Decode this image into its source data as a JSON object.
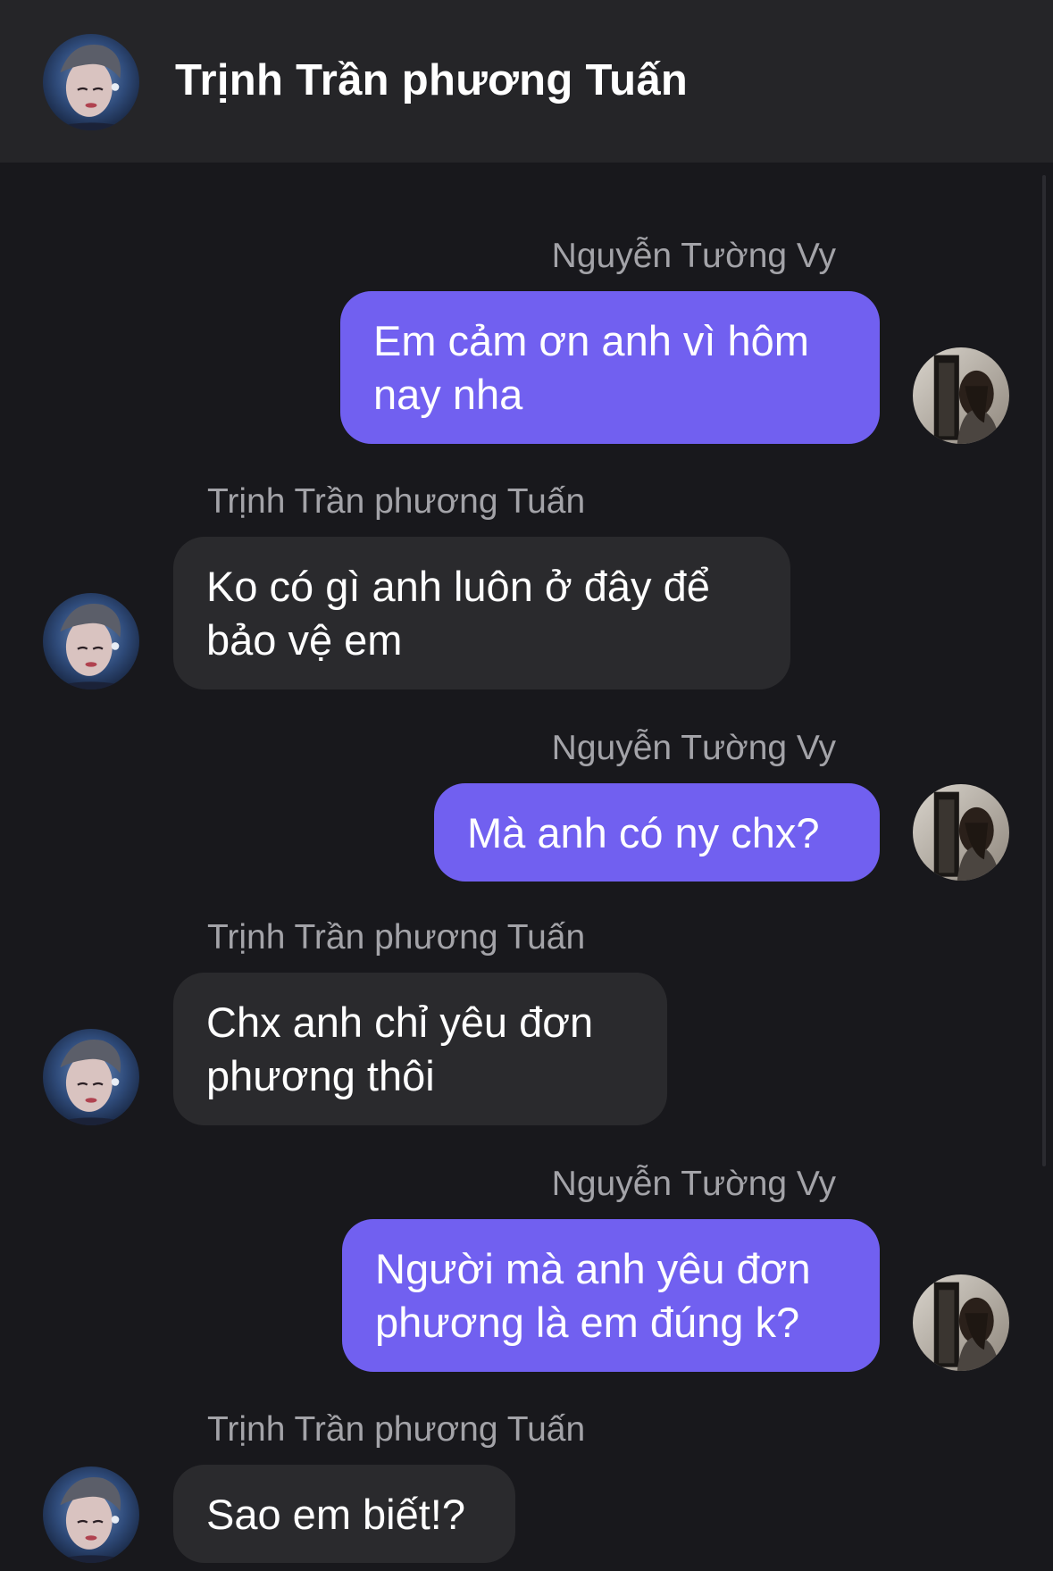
{
  "header": {
    "title": "Trịnh Trần phương Tuấn",
    "avatar_icon": "contact-avatar"
  },
  "participants": {
    "me": "Nguyễn Tường Vy",
    "them": "Trịnh Trần phương Tuấn"
  },
  "colors": {
    "sent_bubble": "#7160f0",
    "received_bubble": "#2a2a2d",
    "header_bg": "#252528",
    "chat_bg": "#18181c",
    "sender_text": "#a3a3a8"
  },
  "messages": [
    {
      "sender": "Nguyễn Tường Vy",
      "from": "me",
      "text": "Em cảm ơn anh vì hôm\nnay nha"
    },
    {
      "sender": "Trịnh Trần phương Tuấn",
      "from": "them",
      "text": "Ko có gì anh luôn ở đây để\nbảo vệ em"
    },
    {
      "sender": "Nguyễn Tường Vy",
      "from": "me",
      "text": "Mà anh có ny chx?"
    },
    {
      "sender": "Trịnh Trần phương Tuấn",
      "from": "them",
      "text": "Chx anh chỉ yêu đơn\nphương thôi"
    },
    {
      "sender": "Nguyễn Tường Vy",
      "from": "me",
      "text": "Người mà anh yêu đơn\nphương là em đúng k?"
    },
    {
      "sender": "Trịnh Trần phương Tuấn",
      "from": "them",
      "text": "Sao em biết!?"
    }
  ]
}
